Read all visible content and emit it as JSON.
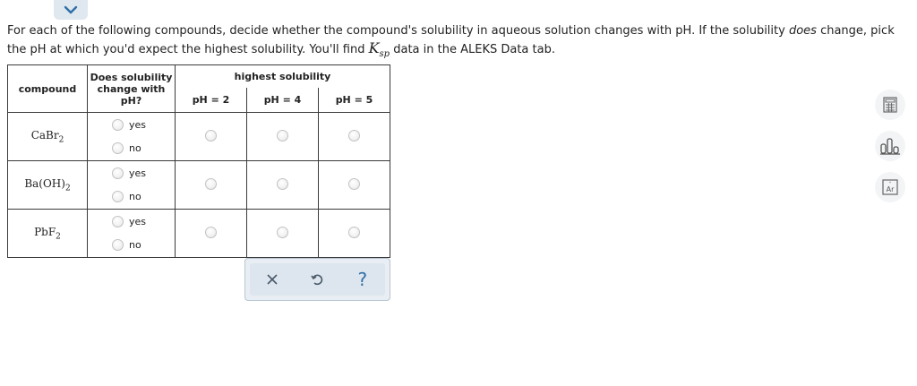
{
  "instructions": {
    "part1": "For each of the following compounds, decide whether the compound's solubility in aqueous solution changes with pH. If the solubility ",
    "emphasis": "does",
    "part2": " change, pick the pH at which you'd expect the highest solubility. You'll find ",
    "ksp_main": "K",
    "ksp_sub": "sp",
    "part3": " data in the ALEKS Data tab."
  },
  "table": {
    "header_compound": "compound",
    "header_change_line1": "Does solubility",
    "header_change_line2": "change with",
    "header_change_line3": "pH?",
    "header_highest": "highest solubility",
    "ph_headers": [
      "pH = 2",
      "pH = 4",
      "pH = 5"
    ],
    "option_yes": "yes",
    "option_no": "no",
    "rows": [
      {
        "formula": "CaBr",
        "subscript": "2"
      },
      {
        "formula": "Ba(OH)",
        "subscript": "2"
      },
      {
        "formula": "PbF",
        "subscript": "2"
      }
    ]
  },
  "toolbar": {
    "clear_icon": "x-icon",
    "undo_icon": "undo-icon",
    "help_label": "?"
  },
  "side_tools": [
    "calculator-icon",
    "data-chart-icon",
    "periodic-table-icon"
  ],
  "side_tools_labels": {
    "periodic_table": "Ar"
  },
  "colors": {
    "accent": "#2f6fa7",
    "tab": "#dfe7ef",
    "toolbar": "#dde6ee"
  }
}
